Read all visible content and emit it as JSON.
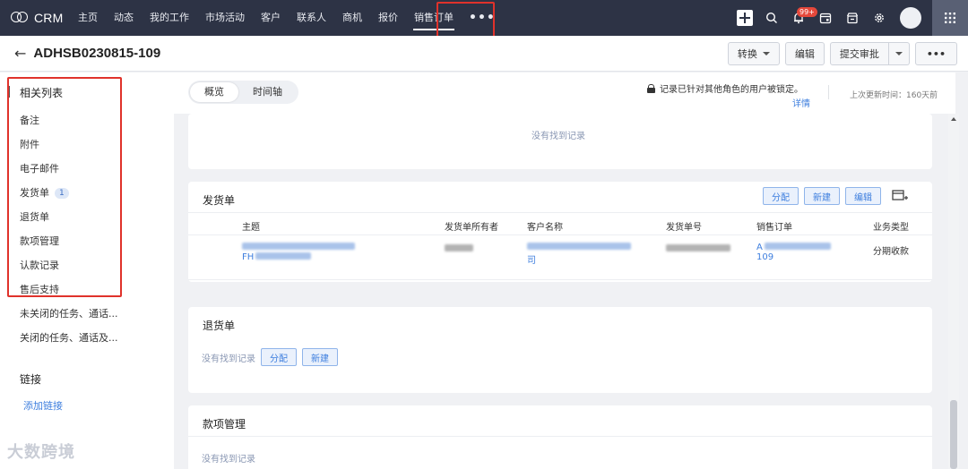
{
  "nav": {
    "logo_text": "CRM",
    "items": [
      {
        "label": "主页"
      },
      {
        "label": "动态"
      },
      {
        "label": "我的工作"
      },
      {
        "label": "市场活动"
      },
      {
        "label": "客户"
      },
      {
        "label": "联系人"
      },
      {
        "label": "商机"
      },
      {
        "label": "报价"
      },
      {
        "label": "销售订单",
        "active": true
      }
    ],
    "more": "•••",
    "notification_count": "99+",
    "icons": [
      "plus-icon",
      "search-icon",
      "bell-icon",
      "calendar-icon",
      "store-icon",
      "gear-icon",
      "avatar",
      "apps-grid-icon"
    ]
  },
  "header": {
    "back": "←",
    "title": "ADHSB0230815-109",
    "actions": {
      "convert": "转换",
      "edit": "编辑",
      "submit": "提交审批",
      "more": "•••"
    }
  },
  "sidebar": {
    "related_title": "相关列表",
    "items": [
      {
        "label": "备注"
      },
      {
        "label": "附件"
      },
      {
        "label": "电子邮件"
      },
      {
        "label": "发货单",
        "count": "1"
      },
      {
        "label": "退货单"
      },
      {
        "label": "款项管理"
      },
      {
        "label": "认款记录"
      },
      {
        "label": "售后支持"
      },
      {
        "label": "未关闭的任务、通话..."
      },
      {
        "label": "关闭的任务、通话及..."
      }
    ],
    "links_title": "链接",
    "add_link": "添加链接",
    "watermark": "大数跨境"
  },
  "main": {
    "tabs": [
      {
        "label": "概览",
        "active": true
      },
      {
        "label": "时间轴"
      }
    ],
    "lock_note": "记录已针对其他角色的用户被锁定。",
    "lock_detail": "详情",
    "last_updated": "上次更新时间：160天前",
    "top_card": {
      "no_record": "没有找到记录"
    },
    "delivery": {
      "title": "发货单",
      "buttons": {
        "assign": "分配",
        "new": "新建",
        "edit": "编辑"
      },
      "columns": [
        "主题",
        "发货单所有者",
        "客户名称",
        "发货单号",
        "销售订单",
        "业务类型"
      ],
      "row": {
        "subject_suffix": "FH",
        "customer_suffix": "司",
        "order_prefix": "A",
        "order_suffix": "109",
        "business_type": "分期收款"
      }
    },
    "returns": {
      "title": "退货单",
      "no_record": "没有找到记录",
      "buttons": {
        "assign": "分配",
        "new": "新建"
      }
    },
    "payments": {
      "title": "款项管理",
      "no_record": "没有找到记录"
    }
  },
  "colors": {
    "nav_bg": "#2d3345",
    "accent": "#3d7ede",
    "highlight": "#e0322b"
  }
}
